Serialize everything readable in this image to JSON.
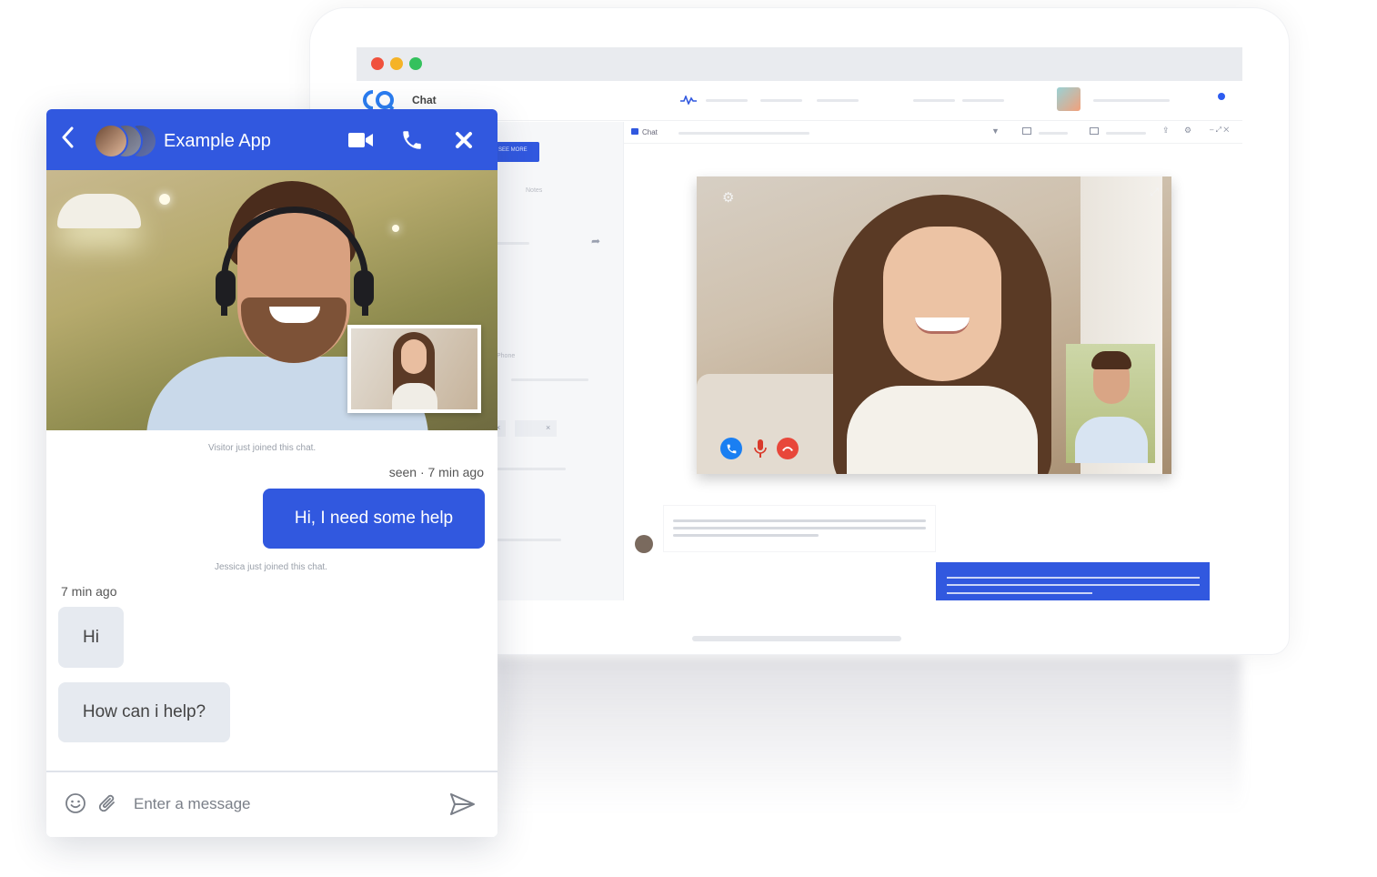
{
  "desktop": {
    "app_label": "Chat",
    "tab_chat_label": "Chat",
    "left_notes": "Notes",
    "left_phone": "Phone",
    "left_button": "SEE MORE",
    "chip_close": "×"
  },
  "mobile": {
    "title": "Example App",
    "back_icon": "chevron-left-icon",
    "messages": {
      "visitor_joined": "Visitor just joined this chat.",
      "seen": "seen · 7 min ago",
      "outgoing": "Hi, I need some help",
      "agent_joined": "Jessica just joined this chat.",
      "incoming_time": "7 min ago",
      "incoming_1": "Hi",
      "incoming_2": "How can i help?"
    },
    "composer": {
      "placeholder": "Enter a message"
    }
  },
  "colors": {
    "accent": "#3158df",
    "call_green": "#1a7ff2",
    "hangup_red": "#e8473a"
  }
}
